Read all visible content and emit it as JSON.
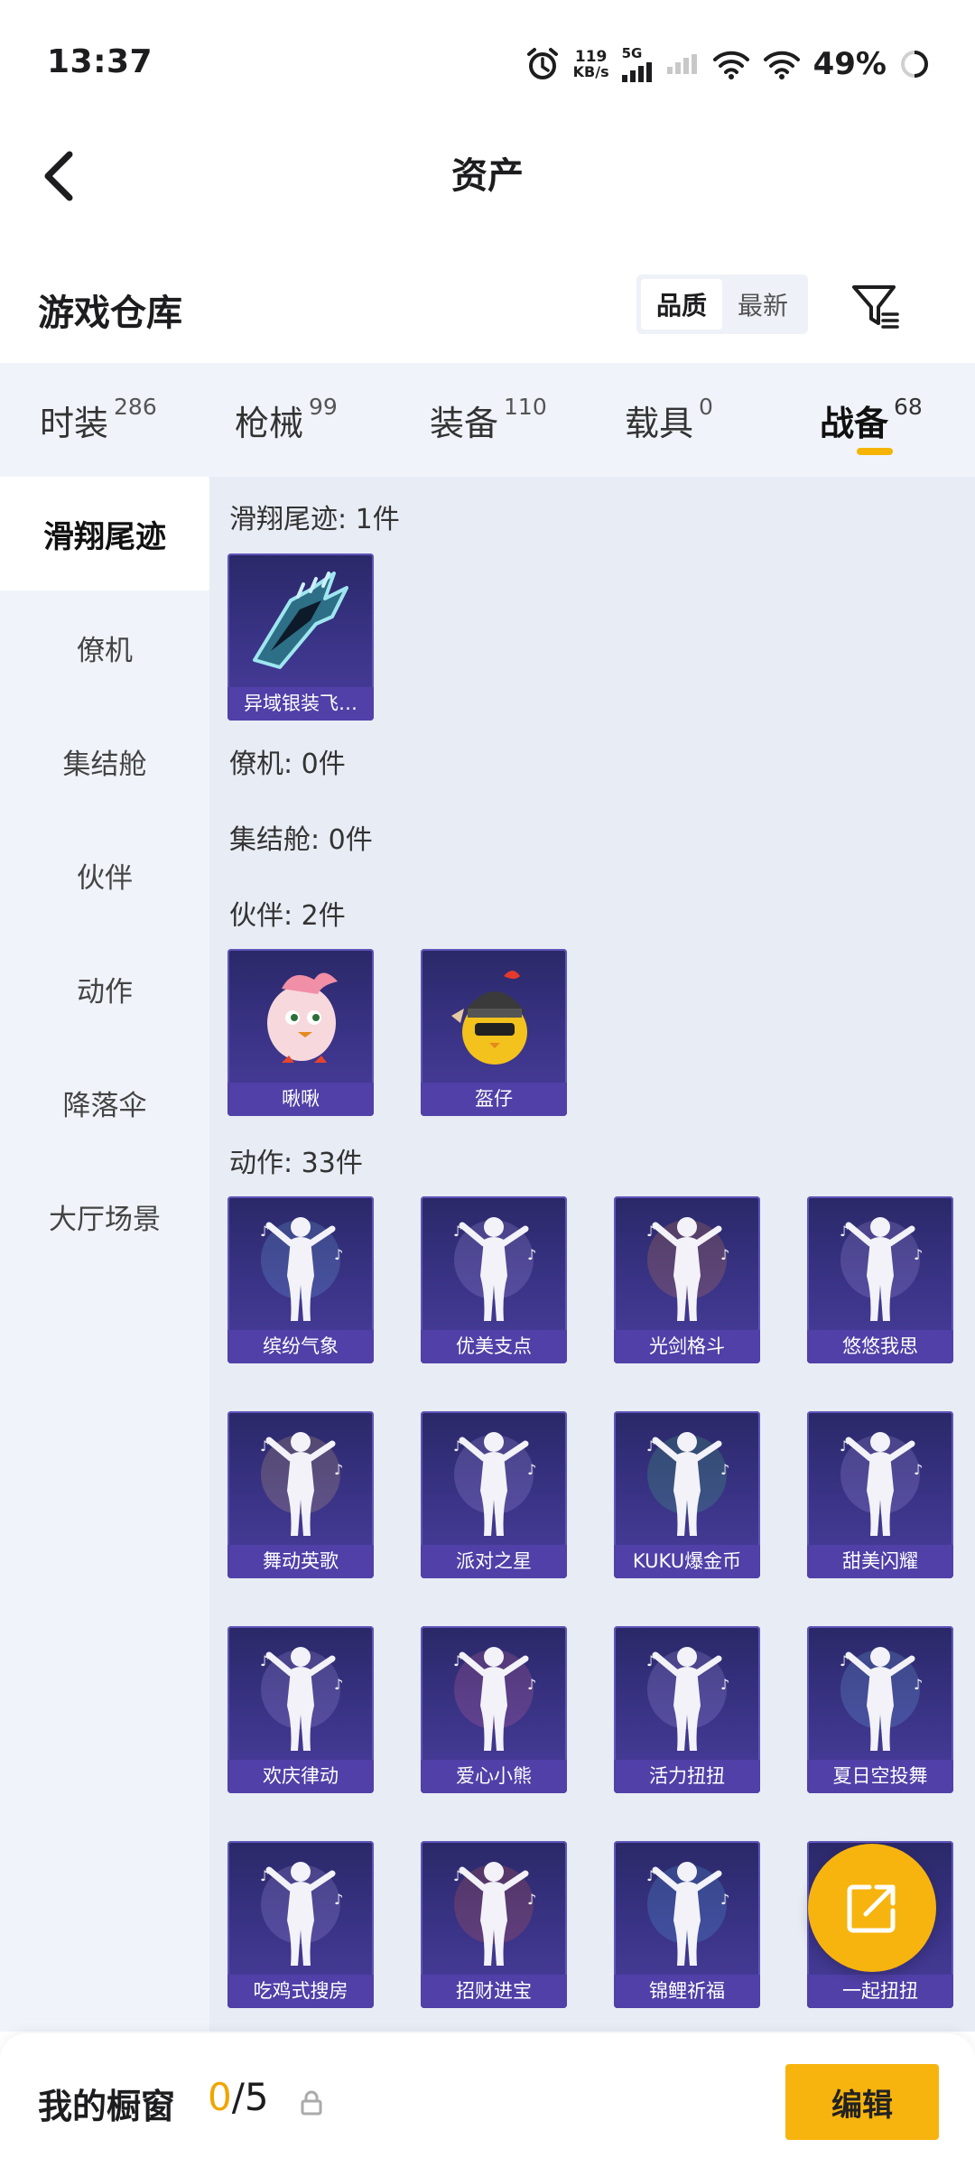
{
  "status_bar": {
    "time": "13:37",
    "net_speed_value": "119",
    "net_speed_unit": "KB/s",
    "network_type": "5G",
    "battery": "49%"
  },
  "header": {
    "title": "资产"
  },
  "warehouse": {
    "title": "游戏仓库",
    "sort_options": [
      "品质",
      "最新"
    ],
    "sort_selected": "品质"
  },
  "tabs": [
    {
      "label": "时装",
      "count": "286"
    },
    {
      "label": "枪械",
      "count": "99"
    },
    {
      "label": "装备",
      "count": "110"
    },
    {
      "label": "载具",
      "count": "0"
    },
    {
      "label": "战备",
      "count": "68"
    }
  ],
  "active_tab": "战备",
  "sidebar": [
    "滑翔尾迹",
    "僚机",
    "集结舱",
    "伙伴",
    "动作",
    "降落伞",
    "大厅场景"
  ],
  "active_sidebar": "滑翔尾迹",
  "sections": {
    "glide_trail": {
      "label": "滑翔尾迹: 1件",
      "items": [
        "异域银装飞…"
      ]
    },
    "wingman": {
      "label": "僚机: 0件"
    },
    "rally_pod": {
      "label": "集结舱: 0件"
    },
    "partner": {
      "label": "伙伴: 2件",
      "items": [
        "啾啾",
        "盔仔"
      ]
    },
    "emote": {
      "label": "动作: 33件",
      "items": [
        "缤纷气象",
        "优美支点",
        "光剑格斗",
        "悠悠我思",
        "舞动英歌",
        "派对之星",
        "KUKU爆金币",
        "甜美闪耀",
        "欢庆律动",
        "爱心小熊",
        "活力扭扭",
        "夏日空投舞",
        "吃鸡式搜房",
        "招财进宝",
        "锦鲤祈福",
        "一起扭扭"
      ]
    }
  },
  "bottom_bar": {
    "title": "我的橱窗",
    "count_current": "0",
    "count_total": "/5",
    "edit_label": "编辑"
  },
  "colors": {
    "accent": "#f7b40e",
    "tab_bg": "#f0f4fa",
    "content_bg": "#e8ecf4",
    "card_bg": "#3b3488",
    "card_label_bg": "#5040a8"
  }
}
